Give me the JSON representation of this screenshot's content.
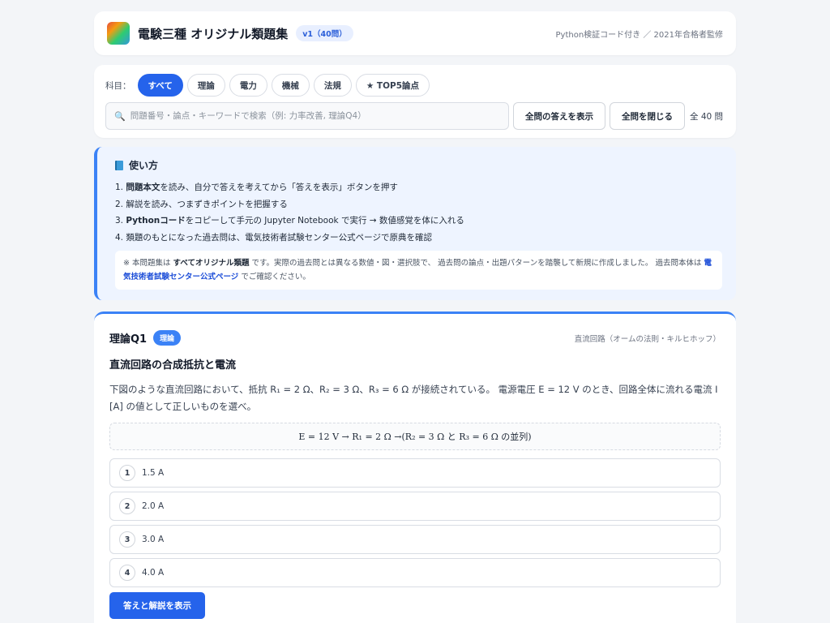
{
  "header": {
    "app_title": "電験三種 オリジナル類題集",
    "version_badge": "v1（40問）",
    "note": "Python検証コード付き ／ 2021年合格者監修"
  },
  "filters": {
    "subject_label": "科目：",
    "chips": [
      {
        "label": "すべて",
        "active": true
      },
      {
        "label": "理論",
        "active": false
      },
      {
        "label": "電力",
        "active": false
      },
      {
        "label": "機械",
        "active": false
      },
      {
        "label": "法規",
        "active": false
      },
      {
        "label": "★ TOP5論点",
        "active": false
      }
    ],
    "search_placeholder": "問題番号・論点・キーワードで検索（例: 力率改善, 理論Q4）",
    "search_icon": "search-icon",
    "show_all_label": "全問の答えを表示",
    "close_all_label": "全問を閉じる",
    "total_count": "全 40 問"
  },
  "howto": {
    "title": "使い方",
    "steps": [
      {
        "prefix": "1. ",
        "bold": "問題本文",
        "rest": "を読み、自分で答えを考えてから「答えを表示」ボタンを押す"
      },
      {
        "prefix": "2. ",
        "bold": "",
        "rest": "解説を読み、つまずきポイントを把握する"
      },
      {
        "prefix": "3. ",
        "bold": "Pythonコード",
        "rest": "をコピーして手元の Jupyter Notebook で実行 → 数値感覚を体に入れる"
      },
      {
        "prefix": "4. ",
        "bold": "",
        "rest": "類題のもとになった過去問は、電気技術者試験センター公式ページで原典を確認"
      }
    ],
    "notice": {
      "part1": "※ 本問題集は ",
      "bold1": "すべてオリジナル類題",
      "part2": " です。実際の過去問とは異なる数値・図・選択肢で、 過去問の論点・出題パターンを踏襲して新規に作成しました。 過去問本体は ",
      "link": "電気技術者試験センター公式ページ",
      "part3": " でご確認ください。"
    }
  },
  "question": {
    "id": "理論Q1",
    "badge": "理論",
    "topic": "直流回路（オームの法則・キルヒホッフ）",
    "title": "直流回路の合成抵抗と電流",
    "body": "下図のような直流回路において、抵抗 R₁ = 2 Ω、R₂ = 3 Ω、R₃ = 6 Ω が接続されている。 電源電圧 E = 12 V のとき、回路全体に流れる電流 I [A] の値として正しいものを選べ。",
    "formula": "E = 12 V → R₁ = 2 Ω →(R₂ = 3 Ω と R₃ = 6 Ω の並列)",
    "choices": [
      {
        "num": "1",
        "text": "1.5 A"
      },
      {
        "num": "2",
        "text": "2.0 A"
      },
      {
        "num": "3",
        "text": "3.0 A"
      },
      {
        "num": "4",
        "text": "4.0 A"
      }
    ],
    "answer_button": "答えと解説を表示"
  }
}
